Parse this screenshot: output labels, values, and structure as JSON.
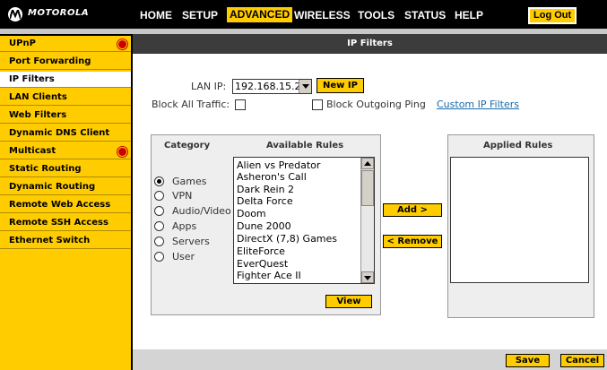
{
  "brand": {
    "logo_text": "MOTOROLA"
  },
  "topnav": {
    "items": [
      "HOME",
      "SETUP",
      "ADVANCED",
      "WIRELESS",
      "TOOLS",
      "STATUS",
      "HELP"
    ],
    "logout": "Log Out",
    "active": "ADVANCED"
  },
  "sidebar": {
    "items": [
      {
        "label": "UPnP",
        "alert": true
      },
      {
        "label": "Port Forwarding",
        "alert": false
      },
      {
        "label": "IP Filters",
        "alert": false,
        "active": true
      },
      {
        "label": "LAN Clients",
        "alert": false
      },
      {
        "label": "Web Filters",
        "alert": false
      },
      {
        "label": "Dynamic DNS Client",
        "alert": false
      },
      {
        "label": "Multicast",
        "alert": true
      },
      {
        "label": "Static Routing",
        "alert": false
      },
      {
        "label": "Dynamic Routing",
        "alert": false
      },
      {
        "label": "Remote Web Access",
        "alert": false
      },
      {
        "label": "Remote SSH Access",
        "alert": false
      },
      {
        "label": "Ethernet Switch",
        "alert": false
      }
    ]
  },
  "page": {
    "title": "IP Filters",
    "lan_ip_label": "LAN IP:",
    "lan_ip_value": "192.168.15.2",
    "new_ip_button": "New IP",
    "block_all_label": "Block All Traffic:",
    "block_ping_label": "Block Outgoing Ping",
    "custom_link": "Custom IP Filters"
  },
  "rules_panel": {
    "category_header": "Category",
    "available_header": "Available Rules",
    "categories": [
      "Games",
      "VPN",
      "Audio/Video",
      "Apps",
      "Servers",
      "User"
    ],
    "selected_category": "Games",
    "available_rules": [
      "Alien vs Predator",
      "Asheron's Call",
      "Dark Rein 2",
      "Delta Force",
      "Doom",
      "Dune 2000",
      "DirectX (7,8) Games",
      "EliteForce",
      "EverQuest",
      "Fighter Ace II"
    ],
    "view_button": "View"
  },
  "actions": {
    "add": "Add >",
    "remove": "< Remove"
  },
  "applied_panel": {
    "header": "Applied Rules"
  },
  "footer": {
    "save": "Save",
    "cancel": "Cancel"
  },
  "colors": {
    "accent": "#ffcc00",
    "header_bg": "#3c3c3c",
    "nav_bg": "#000000",
    "alert": "#cc0000",
    "link": "#1a6aa6"
  }
}
